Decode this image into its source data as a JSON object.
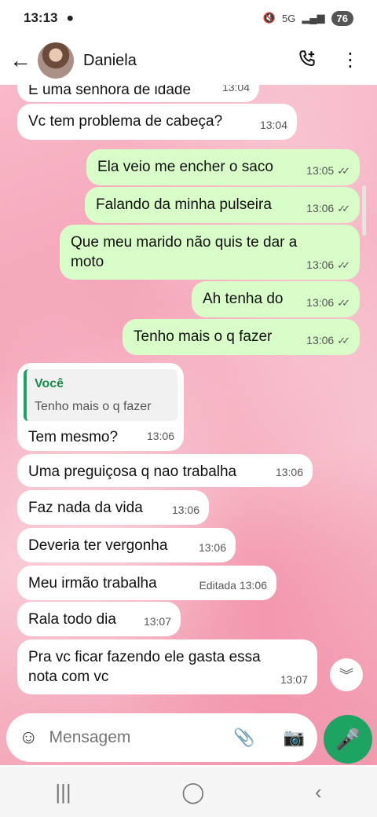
{
  "status": {
    "time": "13:13",
    "network": "5G",
    "battery": "76"
  },
  "header": {
    "contact_name": "Daniela"
  },
  "messages": [
    {
      "dir": "in",
      "text": "E uma senhora de idade",
      "time": "13:04"
    },
    {
      "dir": "in",
      "text": "Vc tem problema de cabeça?",
      "time": "13:04"
    },
    {
      "dir": "out",
      "text": "Ela veio me encher o saco",
      "time": "13:05"
    },
    {
      "dir": "out",
      "text": "Falando da minha pulseira",
      "time": "13:06"
    },
    {
      "dir": "out",
      "text": "Que meu marido não quis te dar a moto",
      "time": "13:06"
    },
    {
      "dir": "out",
      "text": "Ah tenha do",
      "time": "13:06"
    },
    {
      "dir": "out",
      "text": "Tenho mais o q fazer",
      "time": "13:06"
    },
    {
      "dir": "in",
      "quote_author": "Você",
      "quote_text": "Tenho mais o q fazer",
      "text": "Tem mesmo?",
      "time": "13:06"
    },
    {
      "dir": "in",
      "text": "Uma preguiçosa q nao trabalha",
      "time": "13:06"
    },
    {
      "dir": "in",
      "text": "Faz nada da vida",
      "time": "13:06"
    },
    {
      "dir": "in",
      "text": "Deveria ter vergonha",
      "time": "13:06"
    },
    {
      "dir": "in",
      "text": "Meu irmão trabalha",
      "time": "13:06",
      "edited": "Editada"
    },
    {
      "dir": "in",
      "text": "Rala todo dia",
      "time": "13:07"
    },
    {
      "dir": "in",
      "text": "Pra vc ficar fazendo ele gasta essa nota com vc",
      "time": "13:07"
    }
  ],
  "composer": {
    "placeholder": "Mensagem"
  },
  "icons": {
    "back": "back-arrow-icon",
    "call": "add-call-icon",
    "menu": "more-vert-icon",
    "emoji": "sticker-icon",
    "attach": "paperclip-icon",
    "camera": "camera-icon",
    "mic": "mic-icon",
    "scroll": "double-chevron-down-icon"
  },
  "colors": {
    "accent": "#1da463",
    "outgoing": "#d8fdc9",
    "incoming": "#ffffff"
  }
}
